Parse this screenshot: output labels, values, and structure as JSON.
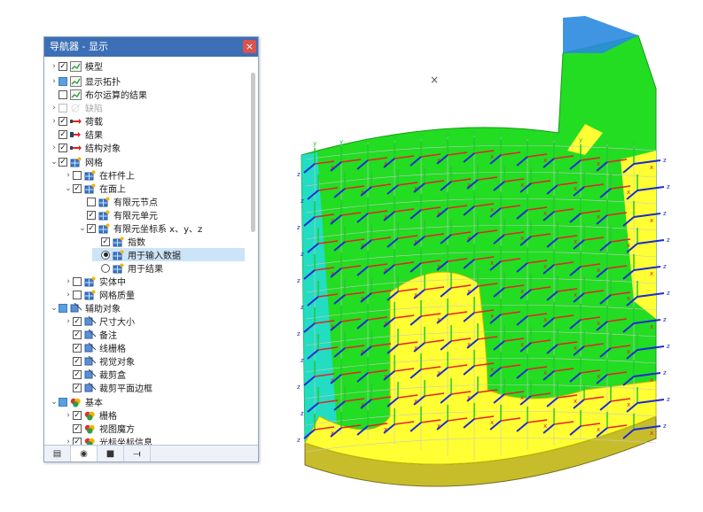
{
  "navigator": {
    "title": "导航器 - 显示",
    "close_label": "×",
    "items": [
      {
        "label": "模型",
        "indent": 0,
        "chev": ">",
        "check": "checked",
        "icon": "chart-icon",
        "dim": false
      },
      {
        "label": "显示拓扑",
        "indent": 0,
        "chev": ">",
        "check": "partial",
        "icon": "chart-icon",
        "dim": false
      },
      {
        "label": "布尔运算的结果",
        "indent": 0,
        "chev": "",
        "check": "unchecked",
        "icon": "chart-icon",
        "dim": false
      },
      {
        "label": "缺陷",
        "indent": 0,
        "chev": ">",
        "check": "disabled",
        "icon": "imperfection-icon",
        "dim": true
      },
      {
        "label": "荷载",
        "indent": 0,
        "chev": ">",
        "check": "checked",
        "icon": "load-icon",
        "dim": false
      },
      {
        "label": "结果",
        "indent": 0,
        "chev": "",
        "check": "checked",
        "icon": "result-icon",
        "dim": false
      },
      {
        "label": "结构对象",
        "indent": 0,
        "chev": ">",
        "check": "checked",
        "icon": "load-icon",
        "dim": false
      },
      {
        "label": "网格",
        "indent": 0,
        "chev": "v",
        "check": "checked",
        "icon": "mesh-icon",
        "dim": false
      },
      {
        "label": "在杆件上",
        "indent": 1,
        "chev": ">",
        "check": "unchecked",
        "icon": "mesh-icon",
        "dim": false
      },
      {
        "label": "在面上",
        "indent": 1,
        "chev": "v",
        "check": "checked",
        "icon": "mesh-icon",
        "dim": false
      },
      {
        "label": "有限元节点",
        "indent": 2,
        "chev": "",
        "check": "unchecked",
        "icon": "mesh-icon",
        "dim": false
      },
      {
        "label": "有限元单元",
        "indent": 2,
        "chev": "",
        "check": "checked",
        "icon": "mesh-icon",
        "dim": false
      },
      {
        "label": "有限元坐标系 x、y、z",
        "indent": 2,
        "chev": "v",
        "check": "checked",
        "icon": "mesh-icon",
        "dim": false
      },
      {
        "label": "指数",
        "indent": 3,
        "chev": "",
        "check": "checked",
        "icon": "mesh-icon",
        "dim": false
      },
      {
        "label": "用于输入数据",
        "indent": 3,
        "chev": "",
        "check": "radio-on",
        "icon": "mesh-icon",
        "dim": false,
        "selected": true
      },
      {
        "label": "用于结果",
        "indent": 3,
        "chev": "",
        "check": "radio-off",
        "icon": "mesh-icon",
        "dim": false
      },
      {
        "label": "实体中",
        "indent": 1,
        "chev": ">",
        "check": "unchecked",
        "icon": "mesh-icon",
        "dim": false
      },
      {
        "label": "网格质量",
        "indent": 1,
        "chev": ">",
        "check": "unchecked",
        "icon": "mesh-icon",
        "dim": false
      },
      {
        "label": "辅助对象",
        "indent": 0,
        "chev": "v",
        "check": "partial",
        "icon": "guide-icon",
        "dim": false
      },
      {
        "label": "尺寸大小",
        "indent": 1,
        "chev": ">",
        "check": "checked",
        "icon": "guide-icon",
        "dim": false
      },
      {
        "label": "备注",
        "indent": 1,
        "chev": "",
        "check": "checked",
        "icon": "guide-icon",
        "dim": false
      },
      {
        "label": "线栅格",
        "indent": 1,
        "chev": "",
        "check": "checked",
        "icon": "guide-icon",
        "dim": false
      },
      {
        "label": "视觉对象",
        "indent": 1,
        "chev": "",
        "check": "checked",
        "icon": "guide-icon",
        "dim": false
      },
      {
        "label": "裁剪盒",
        "indent": 1,
        "chev": "",
        "check": "checked",
        "icon": "guide-icon",
        "dim": false
      },
      {
        "label": "裁剪平面边框",
        "indent": 1,
        "chev": "",
        "check": "checked",
        "icon": "guide-icon",
        "dim": false
      },
      {
        "label": "基本",
        "indent": 0,
        "chev": "v",
        "check": "partial",
        "icon": "basic-icon",
        "dim": false
      },
      {
        "label": "栅格",
        "indent": 1,
        "chev": ">",
        "check": "checked",
        "icon": "basic-icon",
        "dim": false
      },
      {
        "label": "视图魔方",
        "indent": 1,
        "chev": "",
        "check": "checked",
        "icon": "basic-icon",
        "dim": false
      },
      {
        "label": "光标坐标信息",
        "indent": 1,
        "chev": ">",
        "check": "checked",
        "icon": "basic-icon",
        "dim": false
      }
    ],
    "tabs": [
      {
        "name": "data-tab",
        "glyph": "▤"
      },
      {
        "name": "display-tab",
        "glyph": "◉"
      },
      {
        "name": "views-tab",
        "glyph": "■"
      },
      {
        "name": "results-tab",
        "glyph": "⟞"
      }
    ]
  },
  "canvas": {
    "cursor_glyph": "×",
    "axis_labels": {
      "x": "x",
      "y": "y",
      "z": "z"
    },
    "colors": {
      "green": "#22dd22",
      "yellow": "#ffff33",
      "cyan": "#22dddd",
      "olive": "#c7bd2a",
      "red_axis": "#e8202a",
      "green_axis": "#22c833",
      "blue_axis": "#1a2ad8"
    }
  }
}
